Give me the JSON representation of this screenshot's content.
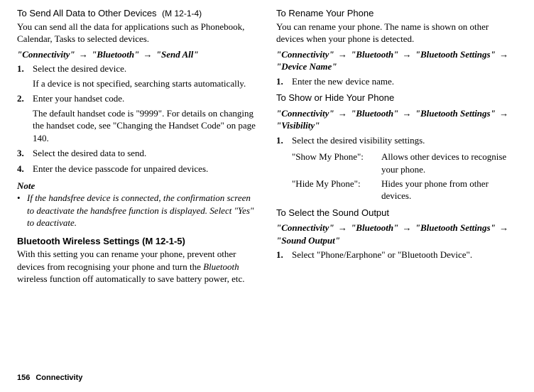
{
  "left": {
    "sec1": {
      "title": "To Send All Data to Other Devices",
      "mcode": "(M 12-1-4)",
      "intro": "You can send all the data for applications such as Phonebook, Calendar, Tasks to selected devices.",
      "path": "\"Connectivity\" → \"Bluetooth\" → \"Send All\"",
      "steps": [
        {
          "num": "1.",
          "text": "Select the desired device.",
          "sub": "If a device is not specified, searching starts automatically."
        },
        {
          "num": "2.",
          "text": "Enter your handset code.",
          "sub": "The default handset code is \"9999\". For details on changing the handset code, see \"Changing the Handset Code\" on page 140."
        },
        {
          "num": "3.",
          "text": "Select the desired data to send."
        },
        {
          "num": "4.",
          "text": "Enter the device passcode for unpaired devices."
        }
      ],
      "noteHead": "Note",
      "noteBullet": "•",
      "note": "If the handsfree device is connected, the confirmation screen to deactivate the handsfree function is displayed. Select \"Yes\" to deactivate."
    },
    "sec2": {
      "title": "Bluetooth Wireless Settings",
      "mcode": "(M 12-1-5)",
      "intro1": "With this setting you can rename your phone, prevent other devices from recognising your phone and turn the ",
      "introItalic": "Bluetooth",
      "intro2": " wireless function off automatically to save battery power, etc."
    }
  },
  "right": {
    "sec3": {
      "title": "To Rename Your Phone",
      "intro": "You can rename your phone. The name is shown on other devices when your phone is detected.",
      "path": "\"Connectivity\" → \"Bluetooth\" → \"Bluetooth Settings\" → \"Device Name\"",
      "step1num": "1.",
      "step1": "Enter the new device name."
    },
    "sec4": {
      "title": "To Show or Hide Your Phone",
      "path": "\"Connectivity\" → \"Bluetooth\" → \"Bluetooth Settings\" → \"Visibility\"",
      "step1num": "1.",
      "step1": "Select the desired visibility settings.",
      "opt1label": "\"Show My Phone\":",
      "opt1desc": "Allows other devices to recognise your phone.",
      "opt2label": "\"Hide My Phone\":",
      "opt2desc": "Hides your phone from other devices."
    },
    "sec5": {
      "title": "To Select the Sound Output",
      "path": "\"Connectivity\" → \"Bluetooth\" → \"Bluetooth Settings\" → \"Sound Output\"",
      "step1num": "1.",
      "step1": "Select \"Phone/Earphone\" or \"Bluetooth Device\"."
    }
  },
  "footer": {
    "page": "156",
    "section": "Connectivity"
  }
}
